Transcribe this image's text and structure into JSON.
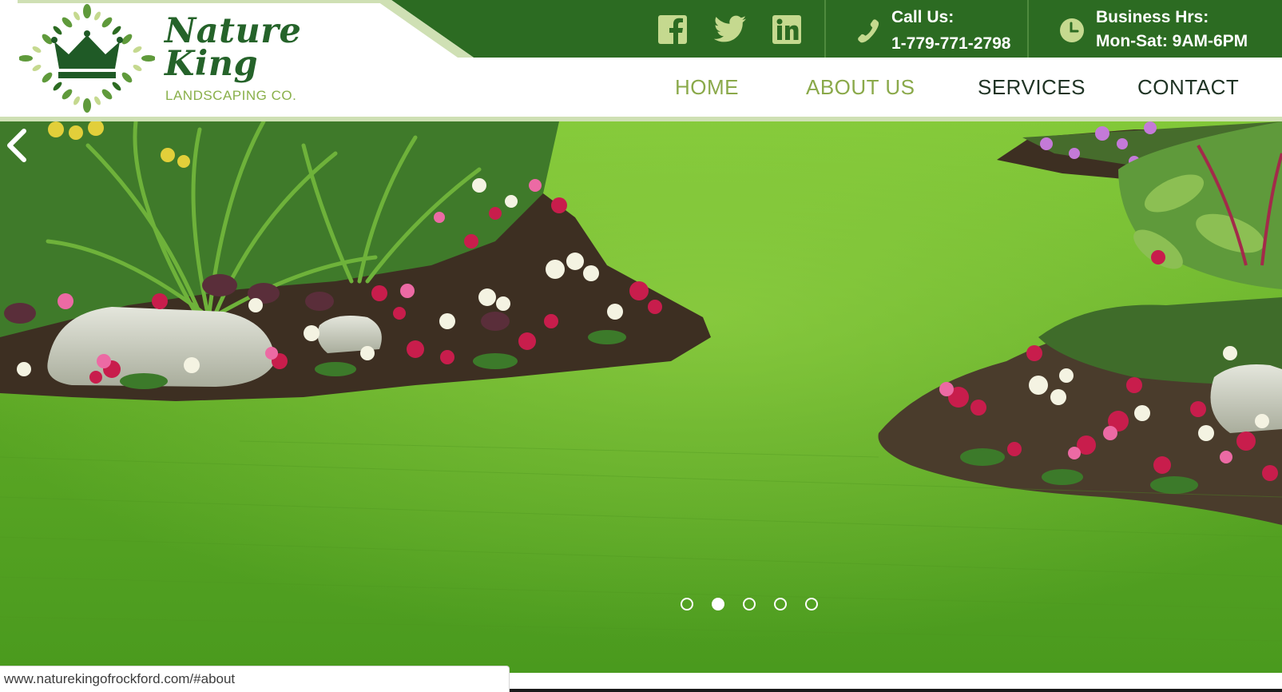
{
  "colors": {
    "brand_dark_green": "#2c6b22",
    "brand_light_green": "#89b04a",
    "nav_active": "#8aa94a",
    "nav_inactive": "#1f3324",
    "icon_fill": "#c5d98f",
    "white": "#ffffff"
  },
  "logo": {
    "name_line_1": "Nature",
    "name_line_2": "King",
    "tagline": "LANDSCAPING CO.",
    "icon": "crown-wreath-logo"
  },
  "social": [
    {
      "name": "facebook",
      "icon": "facebook-icon"
    },
    {
      "name": "twitter",
      "icon": "twitter-icon"
    },
    {
      "name": "linkedin",
      "icon": "linkedin-icon"
    }
  ],
  "contact": {
    "call_label": "Call Us:",
    "phone": "1-779-771-2798",
    "hours_label": "Business Hrs:",
    "hours": "Mon-Sat: 9AM-6PM"
  },
  "nav": {
    "items": [
      {
        "label": "HOME",
        "active": true
      },
      {
        "label": "ABOUT US",
        "active": true
      },
      {
        "label": "SERVICES",
        "active": false
      },
      {
        "label": "CONTACT",
        "active": false
      }
    ]
  },
  "hero": {
    "image_alt": "garden lawn with flower beds",
    "prev_icon": "chevron-left-icon",
    "slide_count": 5,
    "active_slide": 2
  },
  "status_bar": {
    "url": "www.naturekingofrockford.com/#about"
  }
}
